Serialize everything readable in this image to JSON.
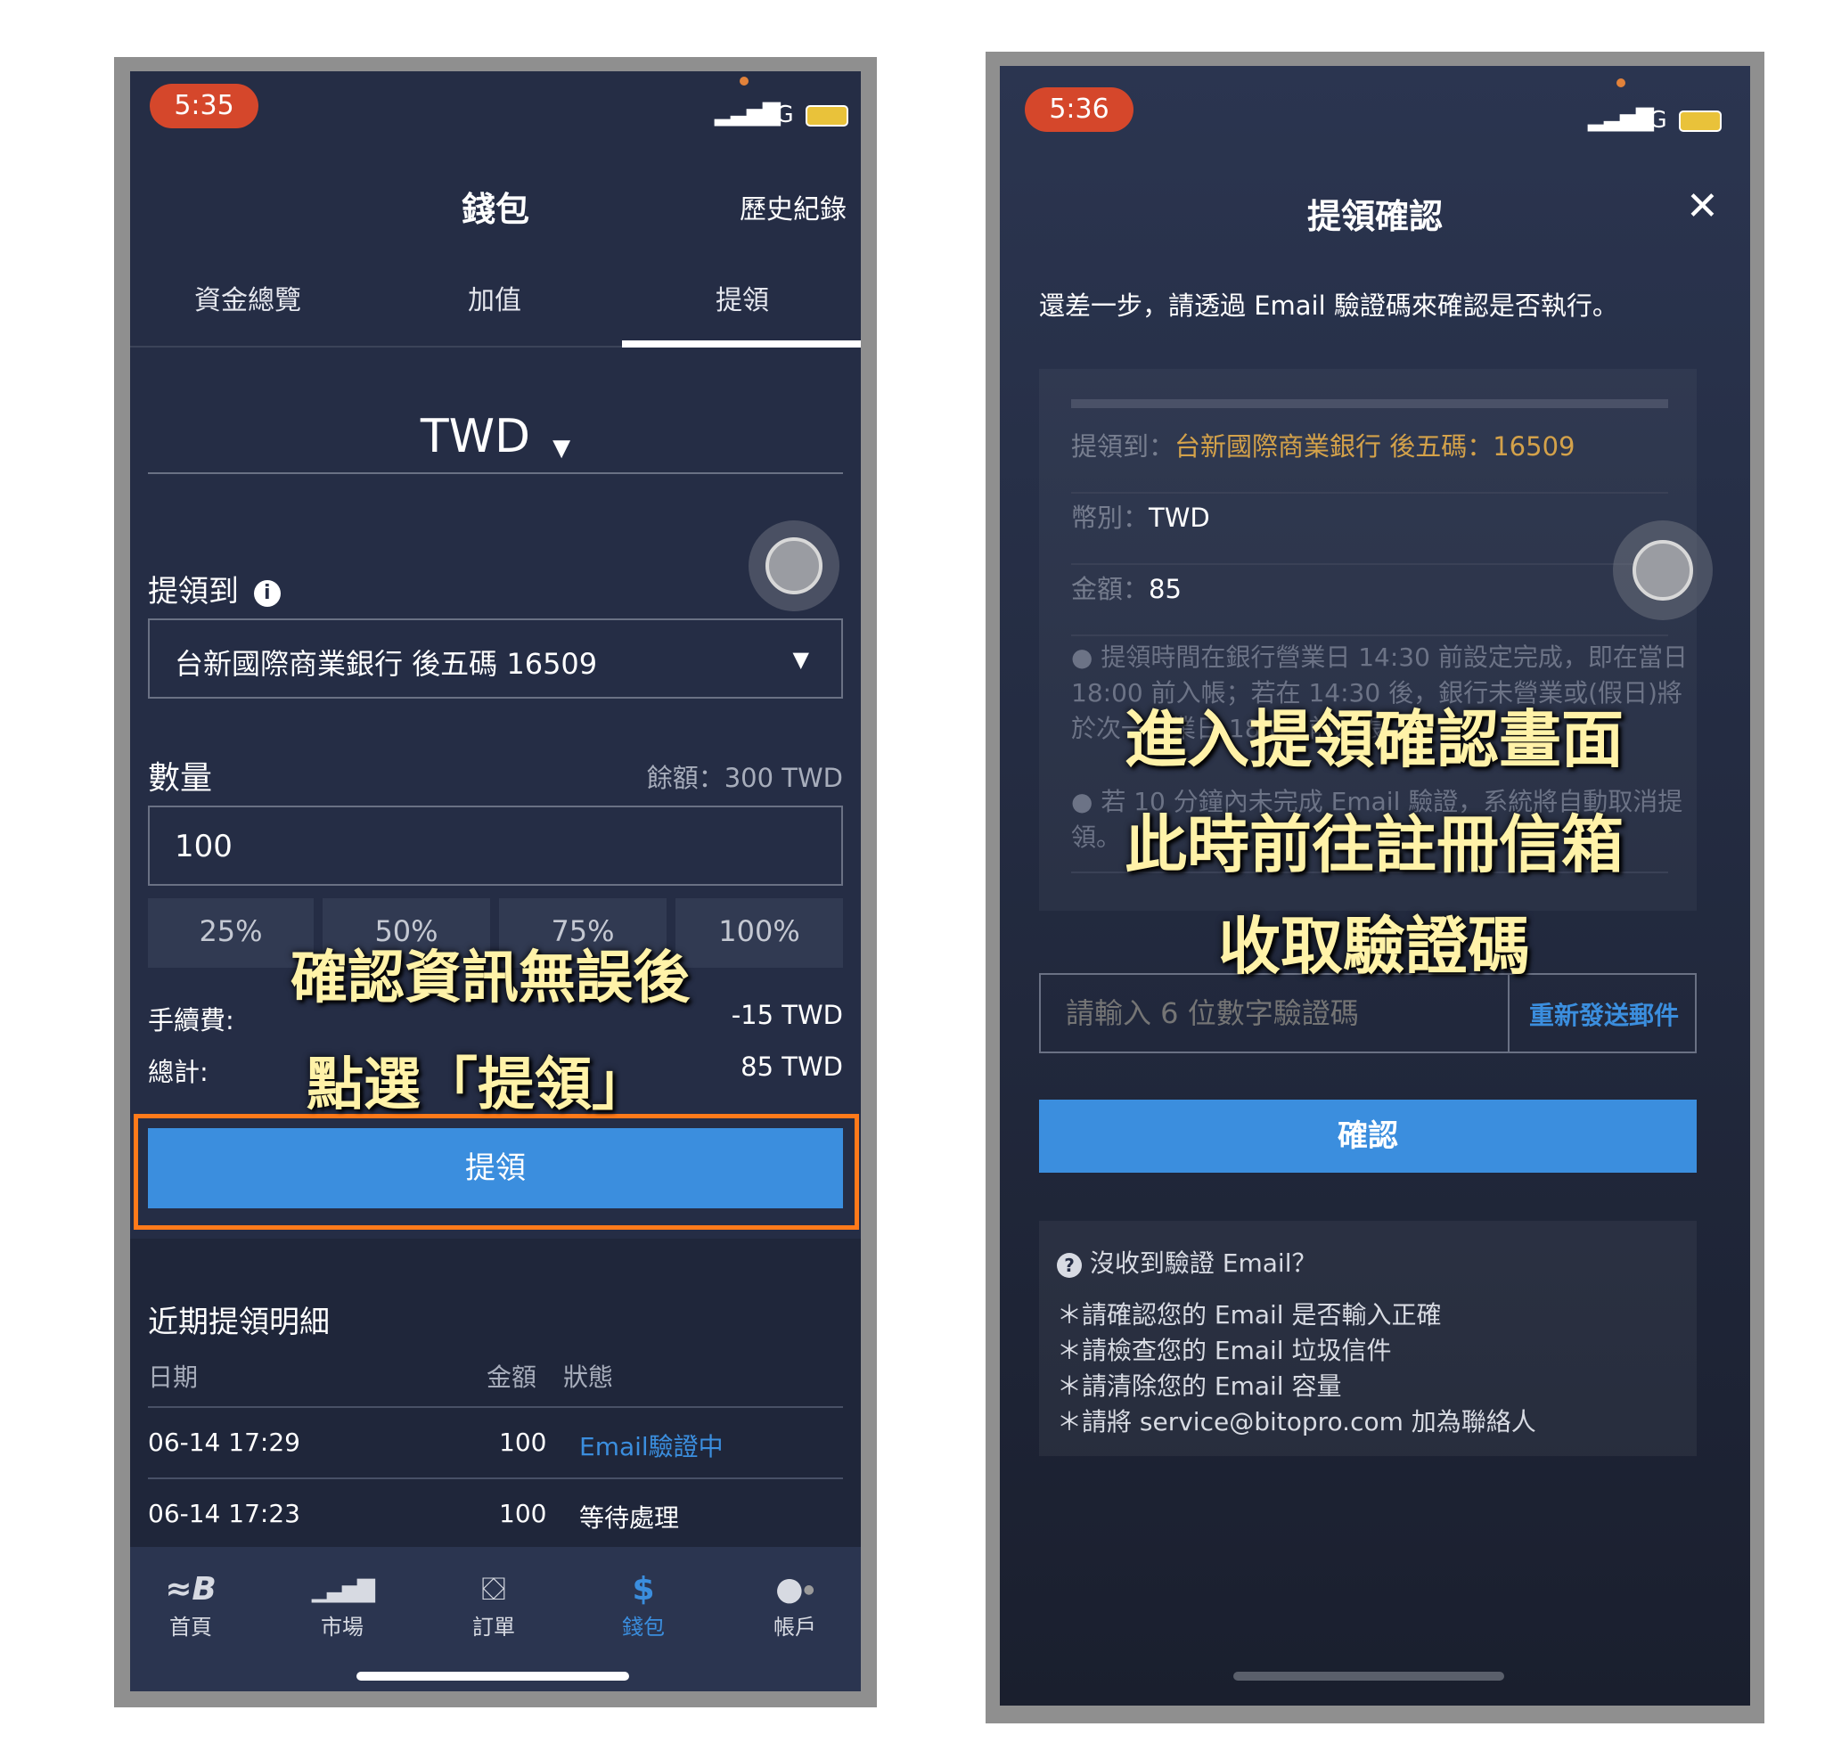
{
  "left": {
    "status": {
      "time": "5:35",
      "network": "4G"
    },
    "header": {
      "title": "錢包",
      "history": "歷史紀錄"
    },
    "tabs": [
      "資金總覽",
      "加值",
      "提領"
    ],
    "currency": "TWD",
    "withdraw_to": {
      "label": "提領到",
      "bank": "台新國際商業銀行 後五碼 16509"
    },
    "amount": {
      "label": "數量",
      "balance": "餘額：300 TWD",
      "value": "100"
    },
    "percent_buttons": [
      "25%",
      "50%",
      "75%",
      "100%"
    ],
    "fee": {
      "label": "手續費:",
      "value": "-15 TWD"
    },
    "total": {
      "label": "總計:",
      "value": "85 TWD"
    },
    "submit": "提領",
    "recent": {
      "title": "近期提領明細",
      "headers": [
        "日期",
        "金額",
        "狀態"
      ],
      "rows": [
        {
          "date": "06-14 17:29",
          "amount": "100",
          "status": "Email驗證中"
        },
        {
          "date": "06-14 17:23",
          "amount": "100",
          "status": "等待處理"
        }
      ]
    },
    "nav": [
      "首頁",
      "市場",
      "訂單",
      "錢包",
      "帳戶"
    ],
    "annotation": [
      "確認資訊無誤後",
      "點選「提領」"
    ]
  },
  "right": {
    "status": {
      "time": "5:36",
      "network": "4G"
    },
    "header": {
      "title": "提領確認",
      "close": "✕"
    },
    "intro": "還差一步，請透過 Email 驗證碼來確認是否執行。",
    "details": {
      "to_label": "提領到：",
      "to_value": "台新國際商業銀行 後五碼：16509",
      "currency_label": "幣別：",
      "currency_value": "TWD",
      "amount_label": "金額：",
      "amount_value": "85"
    },
    "notes": [
      "提領時間在銀行營業日 14:30 前設定完成，即在當日 18:00 前入帳；若在 14:30 後，銀行未營業或(假日)將於次一營業日 18:00 前入帳。",
      "若 10 分鐘內未完成 Email 驗證，系統將自動取消提領。"
    ],
    "code_input": {
      "placeholder": "請輸入 6 位數字驗證碼",
      "resend": "重新發送郵件"
    },
    "confirm": "確認",
    "help": {
      "title": "沒收到驗證 Email？",
      "items": [
        "＊請確認您的 Email 是否輸入正確",
        "＊請檢查您的 Email 垃圾信件",
        "＊請清除您的 Email 容量",
        "＊請將 service@bitopro.com 加為聯絡人"
      ]
    },
    "annotation": [
      "進入提領確認畫面",
      "此時前往註冊信箱",
      "收取驗證碼"
    ]
  },
  "colors": {
    "accent": "#3b8ede",
    "highlight": "#ff7a1a",
    "annotation": "#fff2a8",
    "gold": "#d4a24a"
  }
}
